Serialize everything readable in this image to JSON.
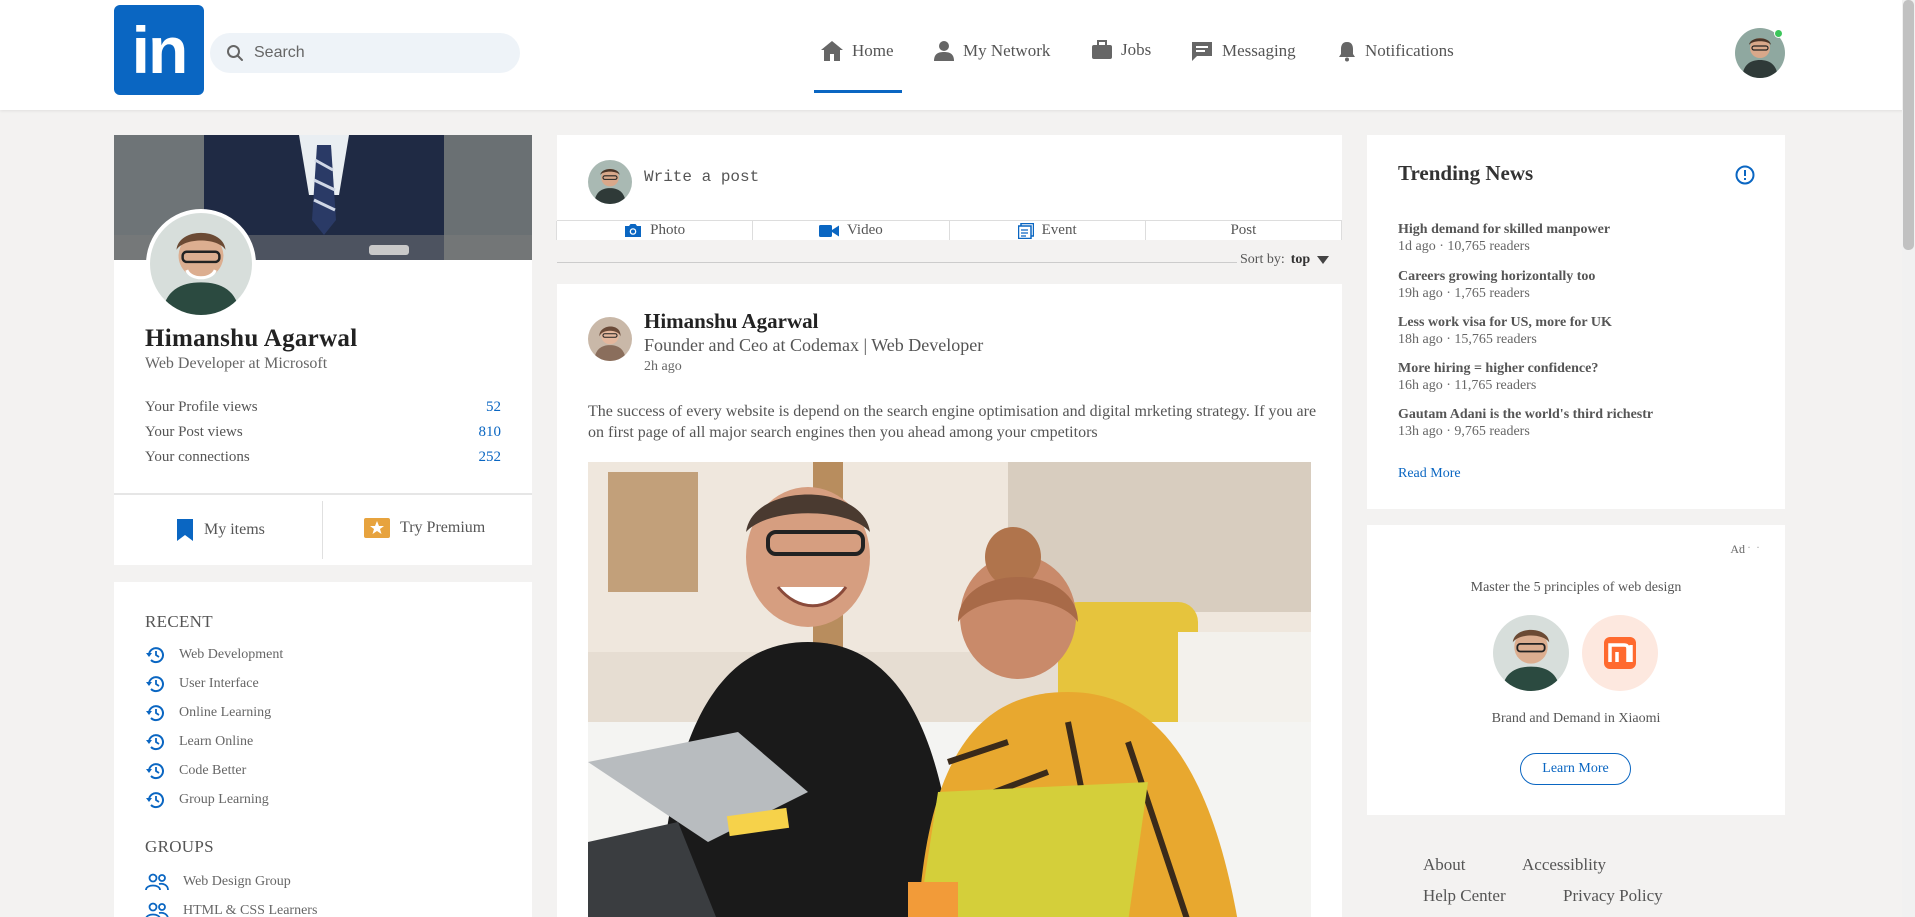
{
  "header": {
    "logo_text": "in",
    "search_placeholder": "Search",
    "nav": [
      {
        "label": "Home",
        "icon": "home-icon"
      },
      {
        "label": "My Network",
        "icon": "person-icon"
      },
      {
        "label": "Jobs",
        "icon": "briefcase-icon"
      },
      {
        "label": "Messaging",
        "icon": "chat-icon"
      },
      {
        "label": "Notifications",
        "icon": "bell-icon"
      }
    ],
    "active_nav": "Home"
  },
  "profile": {
    "name": "Himanshu Agarwal",
    "title": "Web Developer at Microsoft",
    "stats": [
      {
        "label": "Your Profile views",
        "value": "52"
      },
      {
        "label": "Your Post views",
        "value": "810"
      },
      {
        "label": "Your connections",
        "value": "252"
      }
    ],
    "my_items": "My items",
    "try_premium": "Try Premium"
  },
  "recent": {
    "title": "RECENT",
    "items": [
      "Web Development",
      "User Interface",
      "Online Learning",
      "Learn Online",
      "Code Better",
      "Group Learning"
    ],
    "groups_title": "GROUPS",
    "groups": [
      "Web Design Group",
      "HTML & CSS Learners"
    ]
  },
  "composer": {
    "placeholder": "Write a post",
    "tabs": [
      {
        "label": "Photo",
        "icon": "camera-icon"
      },
      {
        "label": "Video",
        "icon": "video-icon"
      },
      {
        "label": "Event",
        "icon": "event-icon"
      },
      {
        "label": "Post",
        "icon": ""
      }
    ],
    "sort_label": "Sort by:",
    "sort_value": "top"
  },
  "post": {
    "author": "Himanshu Agarwal",
    "headline": "Founder and Ceo at Codemax | Web Developer",
    "time": "2h ago",
    "text": "The success of every website is depend on the search engine optimisation and digital mrketing strategy. If you are on first page of all major search engines then you ahead among your cmpetitors"
  },
  "trending": {
    "title": "Trending News",
    "items": [
      {
        "title": "High demand for skilled manpower",
        "meta": "1d ago · 10,765 readers"
      },
      {
        "title": "Careers growing horizontally too",
        "meta": "19h ago · 1,765 readers"
      },
      {
        "title": "Less work visa for US, more for UK",
        "meta": "18h ago · 15,765 readers"
      },
      {
        "title": "More hiring = higher confidence?",
        "meta": "16h ago · 11,765 readers"
      },
      {
        "title": "Gautam Adani is the world's third richestr",
        "meta": "13h ago · 9,765 readers"
      }
    ],
    "read_more": "Read More"
  },
  "ad": {
    "label": "Ad",
    "dots": "· · ·",
    "headline": "Master the 5 principles of web design",
    "caption": "Brand and Demand in Xiaomi",
    "button": "Learn More"
  },
  "footer": {
    "links": [
      "About",
      "Accessiblity",
      "Help Center",
      "Privacy Policy"
    ]
  },
  "colors": {
    "brand": "#0a66c2",
    "premium": "#e7a33e",
    "background": "#f3f2f1"
  }
}
